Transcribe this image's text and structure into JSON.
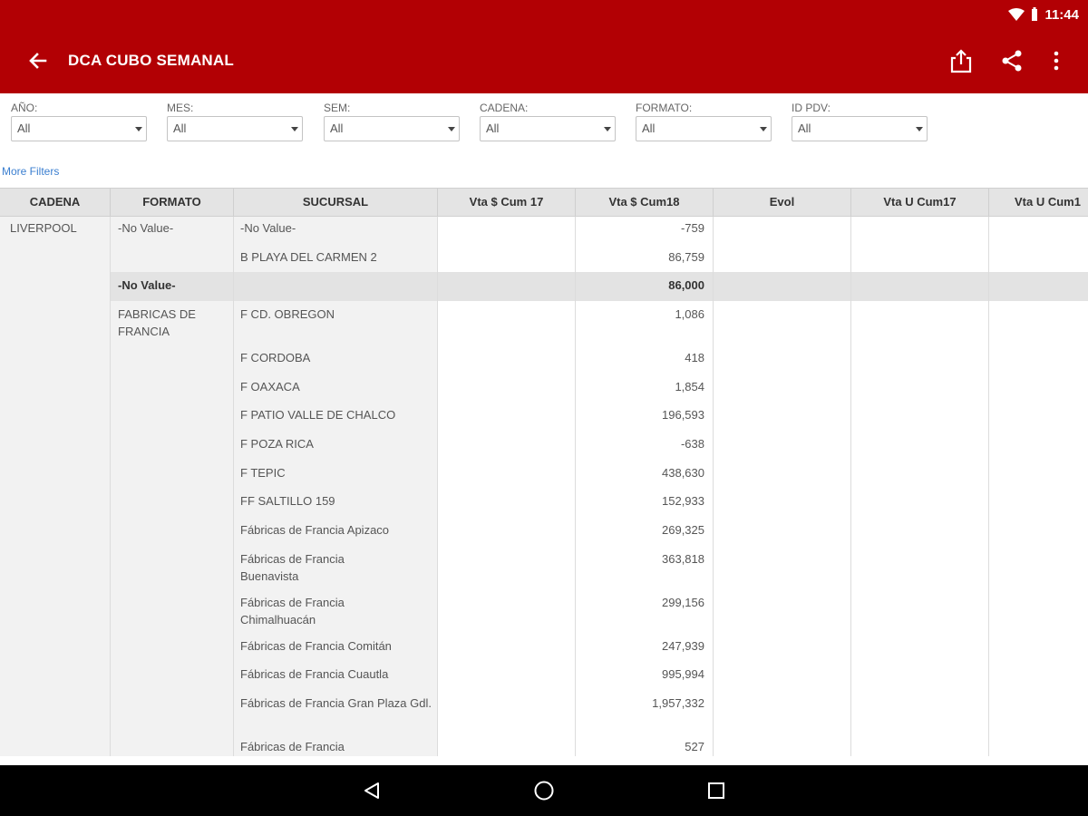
{
  "status_bar": {
    "time": "11:44"
  },
  "app_bar": {
    "title": "DCA CUBO SEMANAL",
    "icons": [
      "back-arrow-icon",
      "export-icon",
      "share-icon",
      "more-vert-icon"
    ]
  },
  "filters": [
    {
      "label": "AÑO:",
      "value": "All"
    },
    {
      "label": "MES:",
      "value": "All"
    },
    {
      "label": "SEM:",
      "value": "All"
    },
    {
      "label": "CADENA:",
      "value": "All"
    },
    {
      "label": "FORMATO:",
      "value": "All"
    },
    {
      "label": "ID PDV:",
      "value": "All"
    }
  ],
  "more_filters": "More Filters",
  "table": {
    "headers": [
      "CADENA",
      "FORMATO",
      "SUCURSAL",
      "Vta $ Cum 17",
      "Vta $ Cum18",
      "Evol",
      "Vta U Cum17",
      "Vta U Cum1"
    ],
    "cadena": "LIVERPOOL",
    "formato_1": "-No Value-",
    "formato_subtotal": "-No Value-",
    "formato_subtotal_value": "86,000",
    "formato_2": "FABRICAS DE FRANCIA",
    "rows": [
      {
        "sucursal": "-No Value-",
        "vta18": "-759"
      },
      {
        "sucursal": "B PLAYA DEL CARMEN 2",
        "vta18": "86,759"
      },
      {
        "sucursal": "F CD. OBREGON",
        "vta18": "1,086"
      },
      {
        "sucursal": "F CORDOBA",
        "vta18": "418"
      },
      {
        "sucursal": "F OAXACA",
        "vta18": "1,854"
      },
      {
        "sucursal": "F PATIO VALLE DE CHALCO",
        "vta18": "196,593"
      },
      {
        "sucursal": "F POZA RICA",
        "vta18": "-638"
      },
      {
        "sucursal": "F TEPIC",
        "vta18": "438,630"
      },
      {
        "sucursal": "FF SALTILLO 159",
        "vta18": "152,933"
      },
      {
        "sucursal": "Fábricas de Francia Apizaco",
        "vta18": "269,325"
      },
      {
        "sucursal": "Fábricas de Francia Buenavista",
        "vta18": "363,818"
      },
      {
        "sucursal": "Fábricas de Francia Chimalhuacán",
        "vta18": "299,156"
      },
      {
        "sucursal": "Fábricas de Francia Comitán",
        "vta18": "247,939"
      },
      {
        "sucursal": "Fábricas de Francia Cuautla",
        "vta18": "995,994"
      },
      {
        "sucursal": "Fábricas de Francia Gran Plaza Gdl.",
        "vta18": "1,957,332"
      },
      {
        "sucursal": "Fábricas de Francia",
        "vta18": "527"
      }
    ]
  },
  "nav_bar": {
    "icons": [
      "back-triangle-icon",
      "home-circle-icon",
      "recents-square-icon"
    ]
  }
}
